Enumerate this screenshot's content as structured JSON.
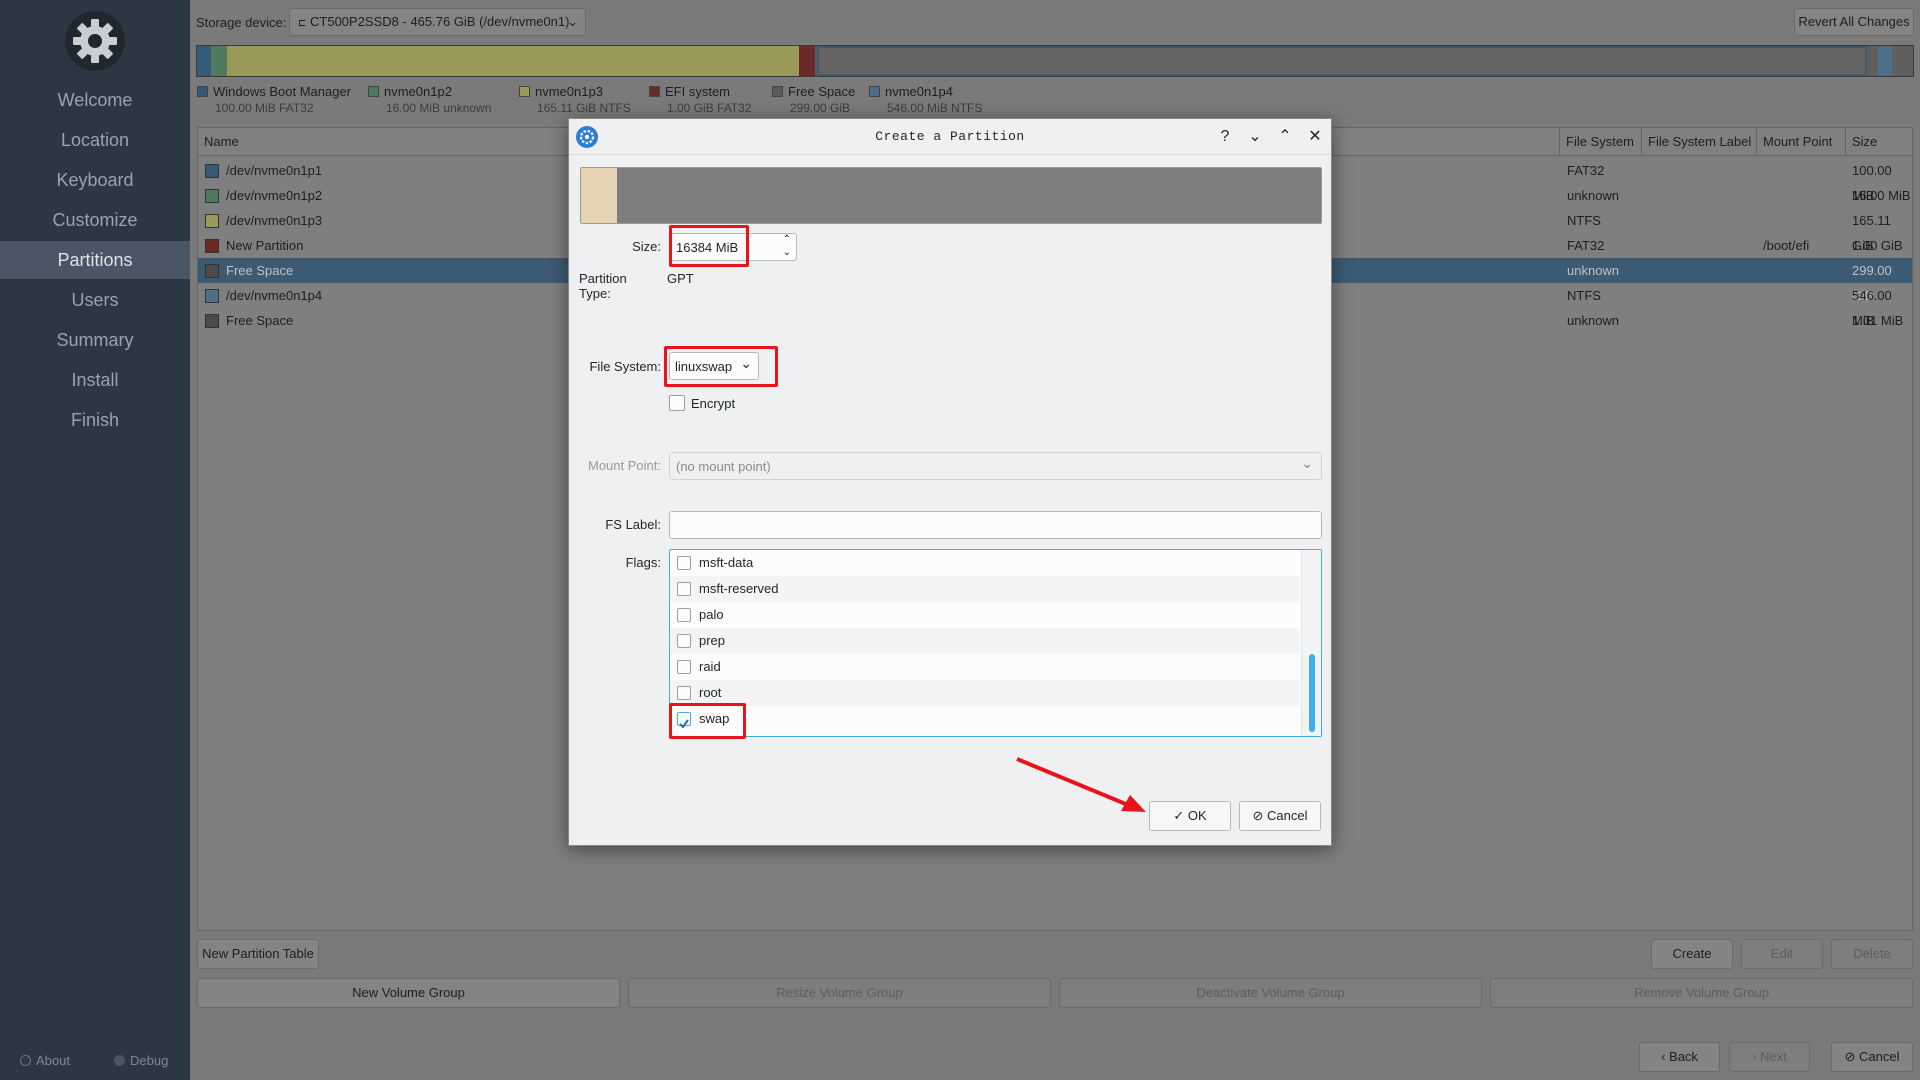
{
  "sidebar": {
    "steps": [
      "Welcome",
      "Location",
      "Keyboard",
      "Customize",
      "Partitions",
      "Users",
      "Summary",
      "Install",
      "Finish"
    ],
    "active_step": "Partitions",
    "about_label": "About",
    "debug_label": "Debug"
  },
  "top": {
    "storage_label": "Storage device:",
    "storage_value": "CT500P2SSD8 - 465.76 GiB (/dev/nvme0n1)",
    "revert_label": "Revert All Changes"
  },
  "legend": [
    {
      "name": "Windows Boot Manager",
      "detail": "100.00 MiB  FAT32",
      "color": "#355a7a"
    },
    {
      "name": "nvme0n1p2",
      "detail": "16.00 MiB  unknown",
      "color": "#4f7a5e"
    },
    {
      "name": "nvme0n1p3",
      "detail": "165.11 GiB  NTFS",
      "color": "#9a9a58"
    },
    {
      "name": "EFI system",
      "detail": "1.00 GiB  FAT32",
      "color": "#6b2a2a"
    },
    {
      "name": "Free Space",
      "detail": "299.00 GiB",
      "color": "#5a5a5a"
    },
    {
      "name": "nvme0n1p4",
      "detail": "546.00 MiB  NTFS",
      "color": "#4f6e8a"
    }
  ],
  "table": {
    "headers": {
      "name": "Name",
      "fs": "File System",
      "fs_label": "File System Label",
      "mount": "Mount Point",
      "size": "Size"
    },
    "rows": [
      {
        "name": "/dev/nvme0n1p1",
        "fs": "FAT32",
        "mount": "",
        "size": "100.00 MiB",
        "color": "#355a7a"
      },
      {
        "name": "/dev/nvme0n1p2",
        "fs": "unknown",
        "mount": "",
        "size": "16.00 MiB",
        "color": "#4f7a5e"
      },
      {
        "name": "/dev/nvme0n1p3",
        "fs": "NTFS",
        "mount": "",
        "size": "165.11 GiB",
        "color": "#9a9a58"
      },
      {
        "name": "New Partition",
        "fs": "FAT32",
        "mount": "/boot/efi",
        "size": "1.00 GiB",
        "color": "#6b2a2a"
      },
      {
        "name": "Free Space",
        "fs": "unknown",
        "mount": "",
        "size": "299.00 GiB",
        "color": "#4a4a4a"
      },
      {
        "name": "/dev/nvme0n1p4",
        "fs": "NTFS",
        "mount": "",
        "size": "546.00 MiB",
        "color": "#4f6e8a"
      },
      {
        "name": "Free Space",
        "fs": "unknown",
        "mount": "",
        "size": "1.01 MiB",
        "color": "#4a4a4a"
      }
    ],
    "selected_row": 4
  },
  "bottom": {
    "new_partition_table": "New Partition Table",
    "create": "Create",
    "edit": "Edit",
    "delete": "Delete",
    "new_volume_group": "New Volume Group",
    "resize_volume_group": "Resize Volume Group",
    "deactivate_volume_group": "Deactivate Volume Group",
    "remove_volume_group": "Remove Volume Group",
    "back": "Back",
    "next": "Next",
    "cancel": "Cancel"
  },
  "dialog": {
    "title": "Create  a  Partition",
    "size_label": "Size:",
    "size_value": "16384 MiB",
    "partition_type_label": "Partition Type:",
    "partition_type_value": "GPT",
    "fs_label": "File System:",
    "fs_value": "linuxswap",
    "encrypt_label": "Encrypt",
    "mount_label": "Mount Point:",
    "mount_value": "(no mount point)",
    "fs_label_label": "FS Label:",
    "fs_label_value": "",
    "flags_label": "Flags:",
    "flags": [
      {
        "name": "msft-data",
        "checked": false
      },
      {
        "name": "msft-reserved",
        "checked": false
      },
      {
        "name": "palo",
        "checked": false
      },
      {
        "name": "prep",
        "checked": false
      },
      {
        "name": "raid",
        "checked": false
      },
      {
        "name": "root",
        "checked": false
      },
      {
        "name": "swap",
        "checked": true
      }
    ],
    "ok_label": "OK",
    "cancel_label": "Cancel"
  }
}
